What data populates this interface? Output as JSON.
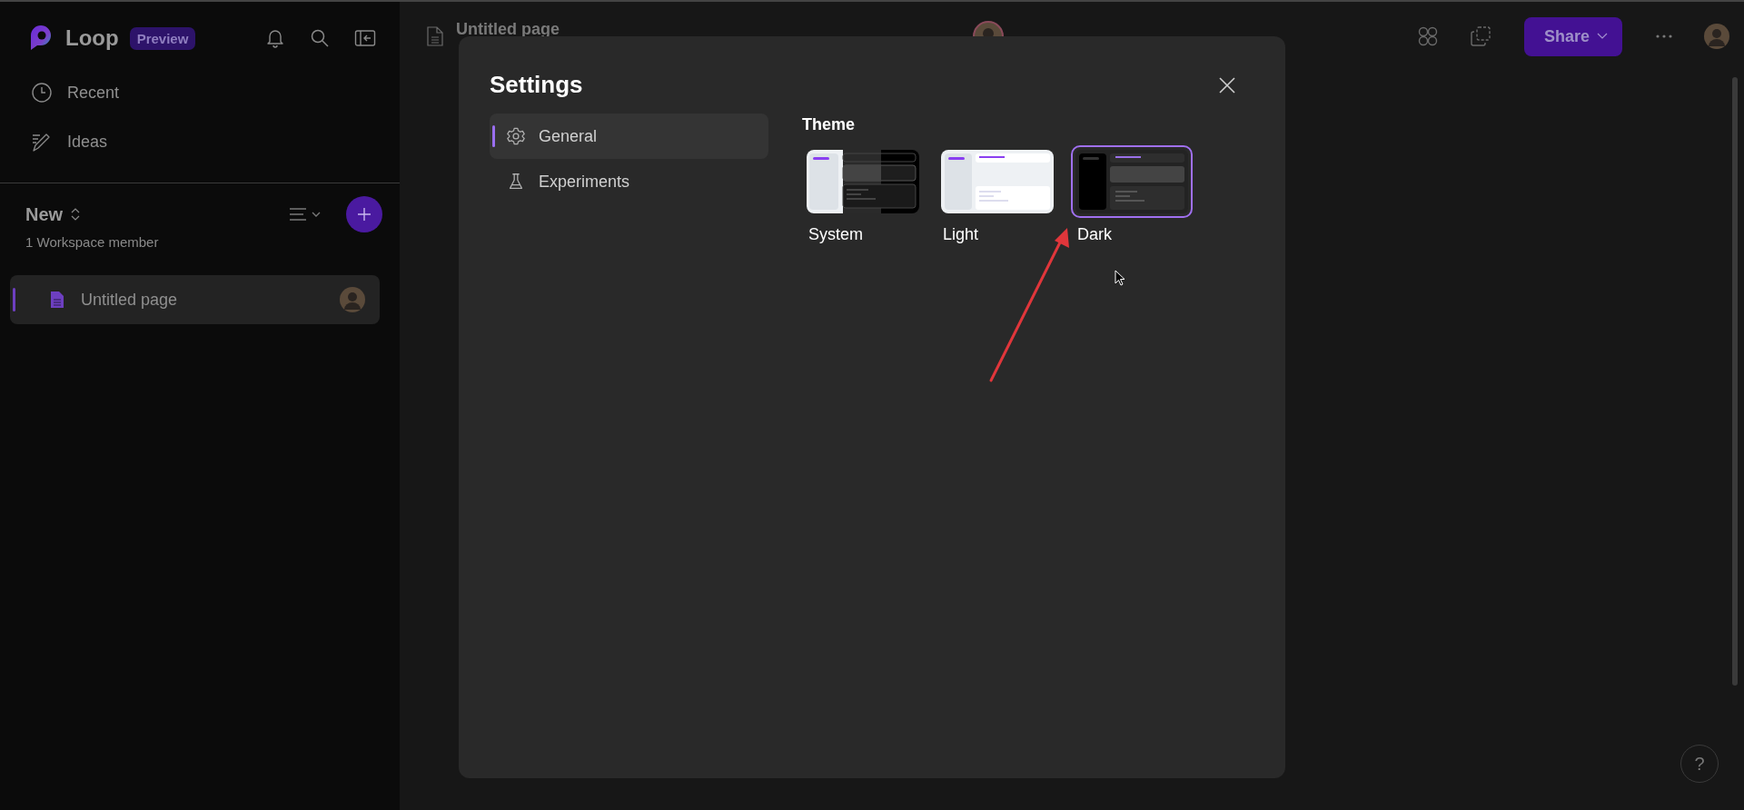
{
  "sidebar": {
    "app_name": "Loop",
    "badge": "Preview",
    "nav": [
      {
        "label": "Recent",
        "kind": "recent"
      },
      {
        "label": "Ideas",
        "kind": "ideas"
      }
    ],
    "workspace": {
      "name": "New",
      "members": "1 Workspace member"
    },
    "pages": [
      {
        "title": "Untitled page",
        "selected": true
      }
    ]
  },
  "header": {
    "page_title": "Untitled page",
    "share": "Share"
  },
  "settings": {
    "title": "Settings",
    "nav": [
      {
        "label": "General",
        "kind": "general",
        "selected": true
      },
      {
        "label": "Experiments",
        "kind": "experiments",
        "selected": false
      }
    ],
    "theme_heading": "Theme",
    "themes": [
      {
        "label": "System",
        "kind": "system",
        "selected": false
      },
      {
        "label": "Light",
        "kind": "light",
        "selected": false
      },
      {
        "label": "Dark",
        "kind": "dark",
        "selected": true
      }
    ]
  },
  "help": "?"
}
